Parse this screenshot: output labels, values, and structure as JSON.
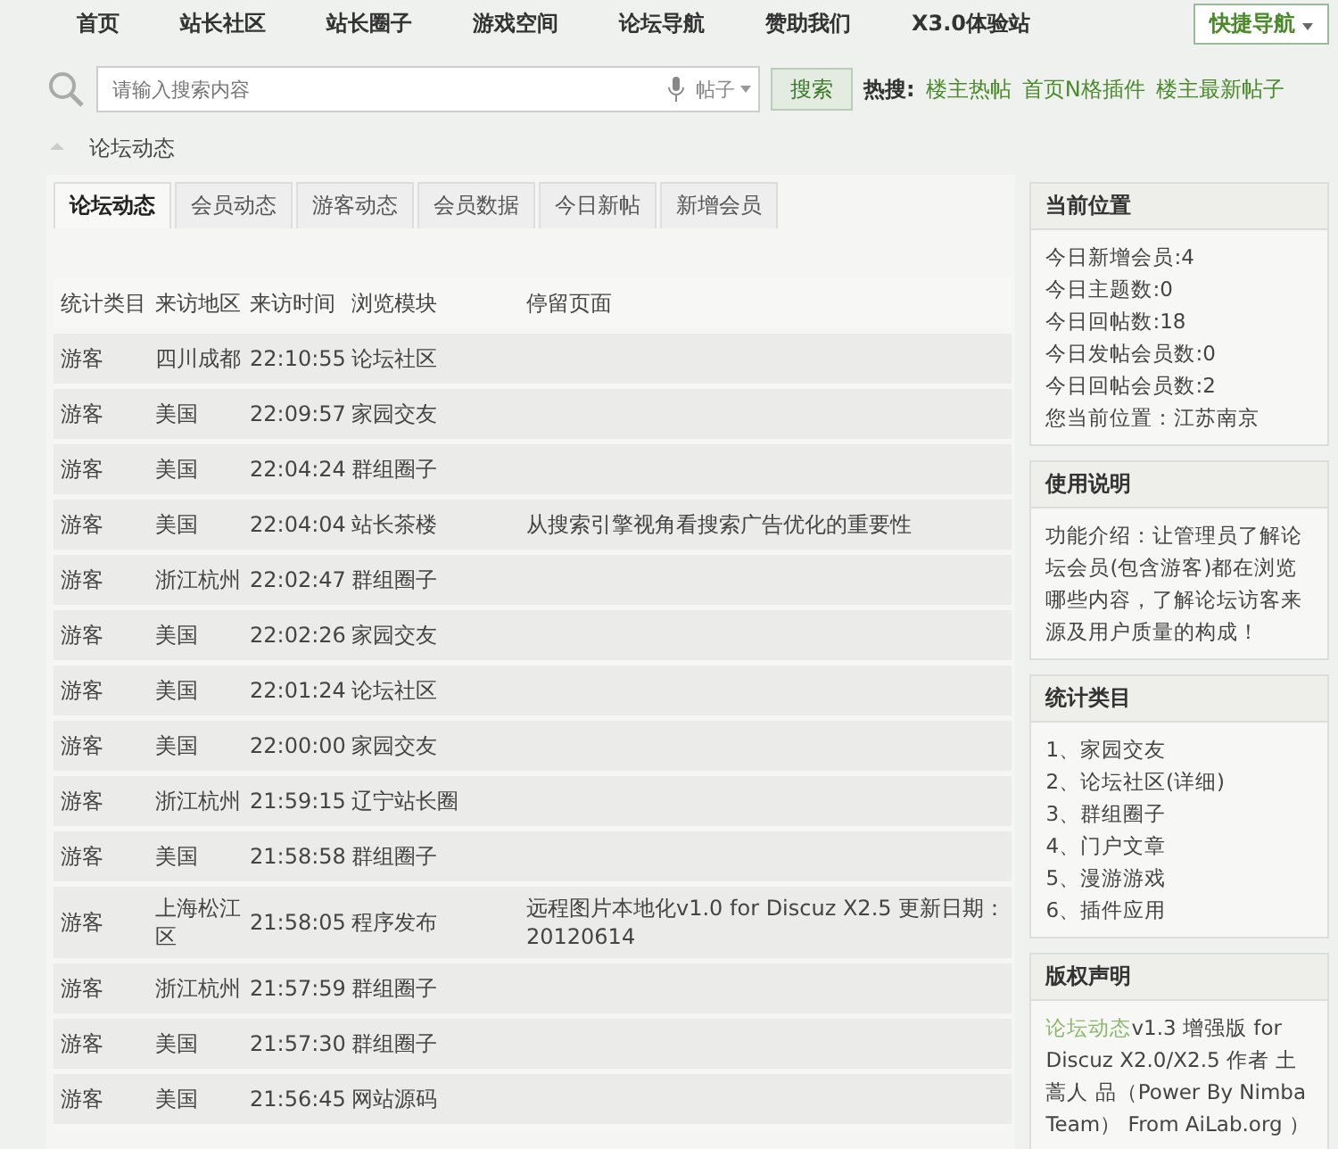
{
  "nav": {
    "items": [
      "首页",
      "站长社区",
      "站长圈子",
      "游戏空间",
      "论坛导航",
      "赞助我们",
      "X3.0体验站"
    ],
    "quick_nav": "快捷导航"
  },
  "search": {
    "placeholder": "请输入搜索内容",
    "scope": "帖子",
    "button": "搜索",
    "hot_label": "热搜:",
    "hot_links": [
      "楼主热帖",
      "首页N格插件",
      "楼主最新帖子"
    ]
  },
  "breadcrumb": "论坛动态",
  "tabs": [
    {
      "label": "论坛动态",
      "selected": true
    },
    {
      "label": "会员动态",
      "selected": false
    },
    {
      "label": "游客动态",
      "selected": false
    },
    {
      "label": "会员数据",
      "selected": false
    },
    {
      "label": "今日新帖",
      "selected": false
    },
    {
      "label": "新增会员",
      "selected": false
    }
  ],
  "table": {
    "columns": [
      "统计类目",
      "来访地区",
      "来访时间",
      "浏览模块",
      "停留页面"
    ],
    "rows": [
      [
        "游客",
        "四川成都",
        "22:10:55",
        "论坛社区",
        ""
      ],
      [
        "游客",
        "美国",
        "22:09:57",
        "家园交友",
        ""
      ],
      [
        "游客",
        "美国",
        "22:04:24",
        "群组圈子",
        ""
      ],
      [
        "游客",
        "美国",
        "22:04:04",
        "站长茶楼",
        "从搜索引擎视角看搜索广告优化的重要性"
      ],
      [
        "游客",
        "浙江杭州",
        "22:02:47",
        "群组圈子",
        ""
      ],
      [
        "游客",
        "美国",
        "22:02:26",
        "家园交友",
        ""
      ],
      [
        "游客",
        "美国",
        "22:01:24",
        "论坛社区",
        ""
      ],
      [
        "游客",
        "美国",
        "22:00:00",
        "家园交友",
        ""
      ],
      [
        "游客",
        "浙江杭州",
        "21:59:15",
        "辽宁站长圈",
        ""
      ],
      [
        "游客",
        "美国",
        "21:58:58",
        "群组圈子",
        ""
      ],
      [
        "游客",
        "上海松江区",
        "21:58:05",
        "程序发布",
        "远程图片本地化v1.0 for Discuz X2.5 更新日期：20120614"
      ],
      [
        "游客",
        "浙江杭州",
        "21:57:59",
        "群组圈子",
        ""
      ],
      [
        "游客",
        "美国",
        "21:57:30",
        "群组圈子",
        ""
      ],
      [
        "游客",
        "美国",
        "21:56:45",
        "网站源码",
        ""
      ]
    ]
  },
  "sidebar": [
    {
      "kind": "lines",
      "title": "当前位置",
      "lines": [
        "今日新增会员:4",
        "今日主题数:0",
        "今日回帖数:18",
        "今日发帖会员数:0",
        "今日回帖会员数:2",
        "您当前位置：江苏南京"
      ]
    },
    {
      "kind": "text",
      "title": "使用说明",
      "text": "功能介绍：让管理员了解论坛会员(包含游客)都在浏览哪些内容，了解论坛访客来源及用户质量的构成！"
    },
    {
      "kind": "lines",
      "title": "统计类目",
      "lines": [
        "1、家园交友",
        "2、论坛社区(详细)",
        "3、群组圈子",
        "4、门户文章",
        "5、漫游游戏",
        "6、插件应用"
      ]
    },
    {
      "kind": "copyright",
      "title": "版权声明",
      "link": "论坛动态",
      "text": "v1.3 增强版 for Discuz X2.0/X2.5 作者 土蒿人 品（Power By Nimba Team） From AiLab.org ）"
    }
  ]
}
